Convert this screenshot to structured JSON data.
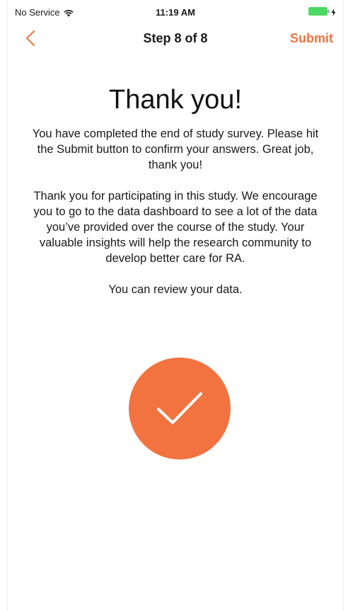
{
  "status_bar": {
    "carrier": "No Service",
    "time": "11:19 AM",
    "wifi_icon": "wifi-icon",
    "battery_icon": "battery-icon",
    "charging_icon": "bolt-icon"
  },
  "nav": {
    "back_icon": "chevron-left-icon",
    "title": "Step 8 of 8",
    "submit_label": "Submit"
  },
  "content": {
    "heading": "Thank you!",
    "paragraph_1": "You have completed the end of study survey. Please hit the Submit button to confirm your answers. Great job, thank you!",
    "paragraph_2": "Thank you for participating in this study. We encourage you to go to the data dashboard to see a lot of the data you’ve provided over the course of the study. Your valuable insights will help the research community to develop better care for RA.",
    "paragraph_3": "You can review your data.",
    "check_icon": "checkmark-icon"
  },
  "colors": {
    "accent": "#f0733f",
    "battery": "#4cd964"
  }
}
